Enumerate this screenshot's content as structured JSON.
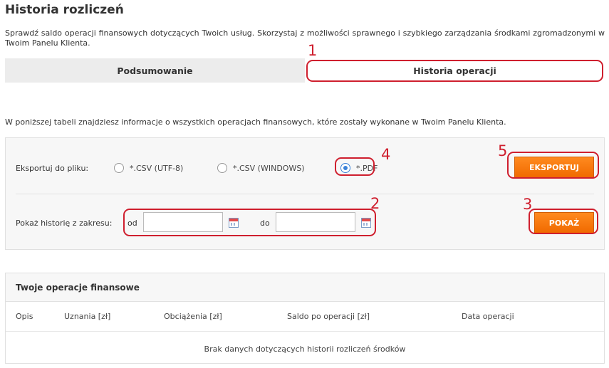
{
  "page": {
    "title": "Historia rozliczeń",
    "intro": "Sprawdź saldo operacji finansowych dotyczących Twoich usług. Skorzystaj z możliwości sprawnego i szybkiego zarządzania środkami zgromadzonymi w Twoim Panelu Klienta."
  },
  "tabs": [
    {
      "label": "Podsumowanie",
      "active": false
    },
    {
      "label": "Historia operacji",
      "active": true
    }
  ],
  "description": "W poniższej tabeli znajdziesz informacje o wszystkich operacjach finansowych, które zostały wykonane w Twoim Panelu Klienta.",
  "export": {
    "label": "Eksportuj do pliku:",
    "options": [
      {
        "label": "*.CSV (UTF-8)",
        "selected": false
      },
      {
        "label": "*.CSV (WINDOWS)",
        "selected": false
      },
      {
        "label": "*.PDF",
        "selected": true
      }
    ],
    "button_label": "EKSPORTUJ"
  },
  "range": {
    "label": "Pokaż historię z zakresu:",
    "from_label": "od",
    "to_label": "do",
    "from_value": "",
    "to_value": "",
    "button_label": "POKAŻ"
  },
  "operations": {
    "title": "Twoje operacje finansowe",
    "columns": [
      "Opis",
      "Uznania [zł]",
      "Obciążenia [zł]",
      "Saldo po operacji [zł]",
      "Data operacji"
    ],
    "empty_message": "Brak danych dotyczących historii rozliczeń środków"
  },
  "annotations": [
    "1",
    "2",
    "3",
    "4",
    "5"
  ],
  "colors": {
    "accent_orange": "#f07a10",
    "annotation_red": "#cf1f2e",
    "radio_blue": "#3b82d8"
  }
}
